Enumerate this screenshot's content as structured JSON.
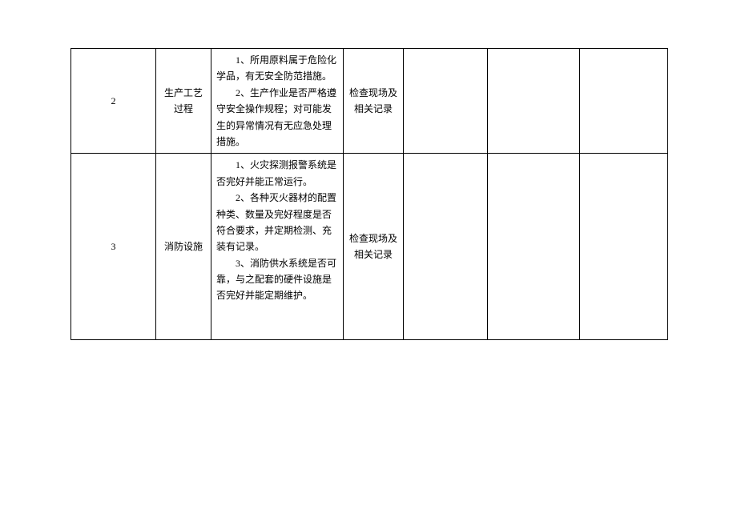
{
  "rows": [
    {
      "num": "2",
      "category": "生产工艺过程",
      "content_1": "1、所用原料属于危险化学品，有无安全防范措施。",
      "content_2": "2、生产作业是否严格遵守安全操作规程；对可能发生的异常情况有无应急处理措施。",
      "method": "检查现场及相关记录"
    },
    {
      "num": "3",
      "category": "消防设施",
      "content_1": "1、火灾探测报警系统是否完好并能正常运行。",
      "content_2": "2、各种灭火器材的配置种类、数量及完好程度是否符合要求，并定期检测、充装有记录。",
      "content_3": "3、消防供水系统是否可靠，与之配套的硬件设施是否完好并能定期维护。",
      "method": "检查现场及相关记录"
    }
  ]
}
